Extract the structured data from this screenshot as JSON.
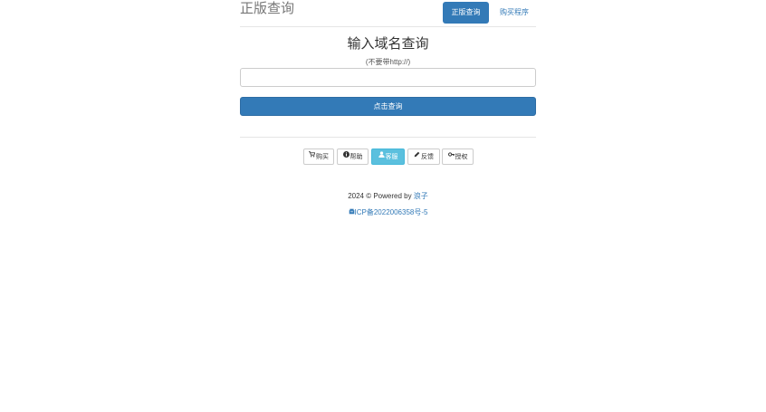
{
  "header": {
    "brand": "正版查询",
    "nav_active": "正版查询",
    "nav_link": "购买程序"
  },
  "main": {
    "title": "输入域名查询",
    "subtitle": "(不要带http://)",
    "input_value": "",
    "input_placeholder": "",
    "submit_label": "点击查询"
  },
  "buttons": [
    {
      "label": "购买",
      "icon": "cart-icon"
    },
    {
      "label": "帮助",
      "icon": "info-circle-icon"
    },
    {
      "label": "客服",
      "icon": "user-icon"
    },
    {
      "label": "反馈",
      "icon": "pencil-icon"
    },
    {
      "label": "授权",
      "icon": "key-icon"
    }
  ],
  "footer": {
    "copyright_prefix": "2024 © Powered by ",
    "powered_by": "浪子",
    "icp": "ICP备2022006358号-5"
  },
  "colors": {
    "primary": "#337ab7",
    "info": "#5bc0de",
    "muted": "#777777"
  }
}
